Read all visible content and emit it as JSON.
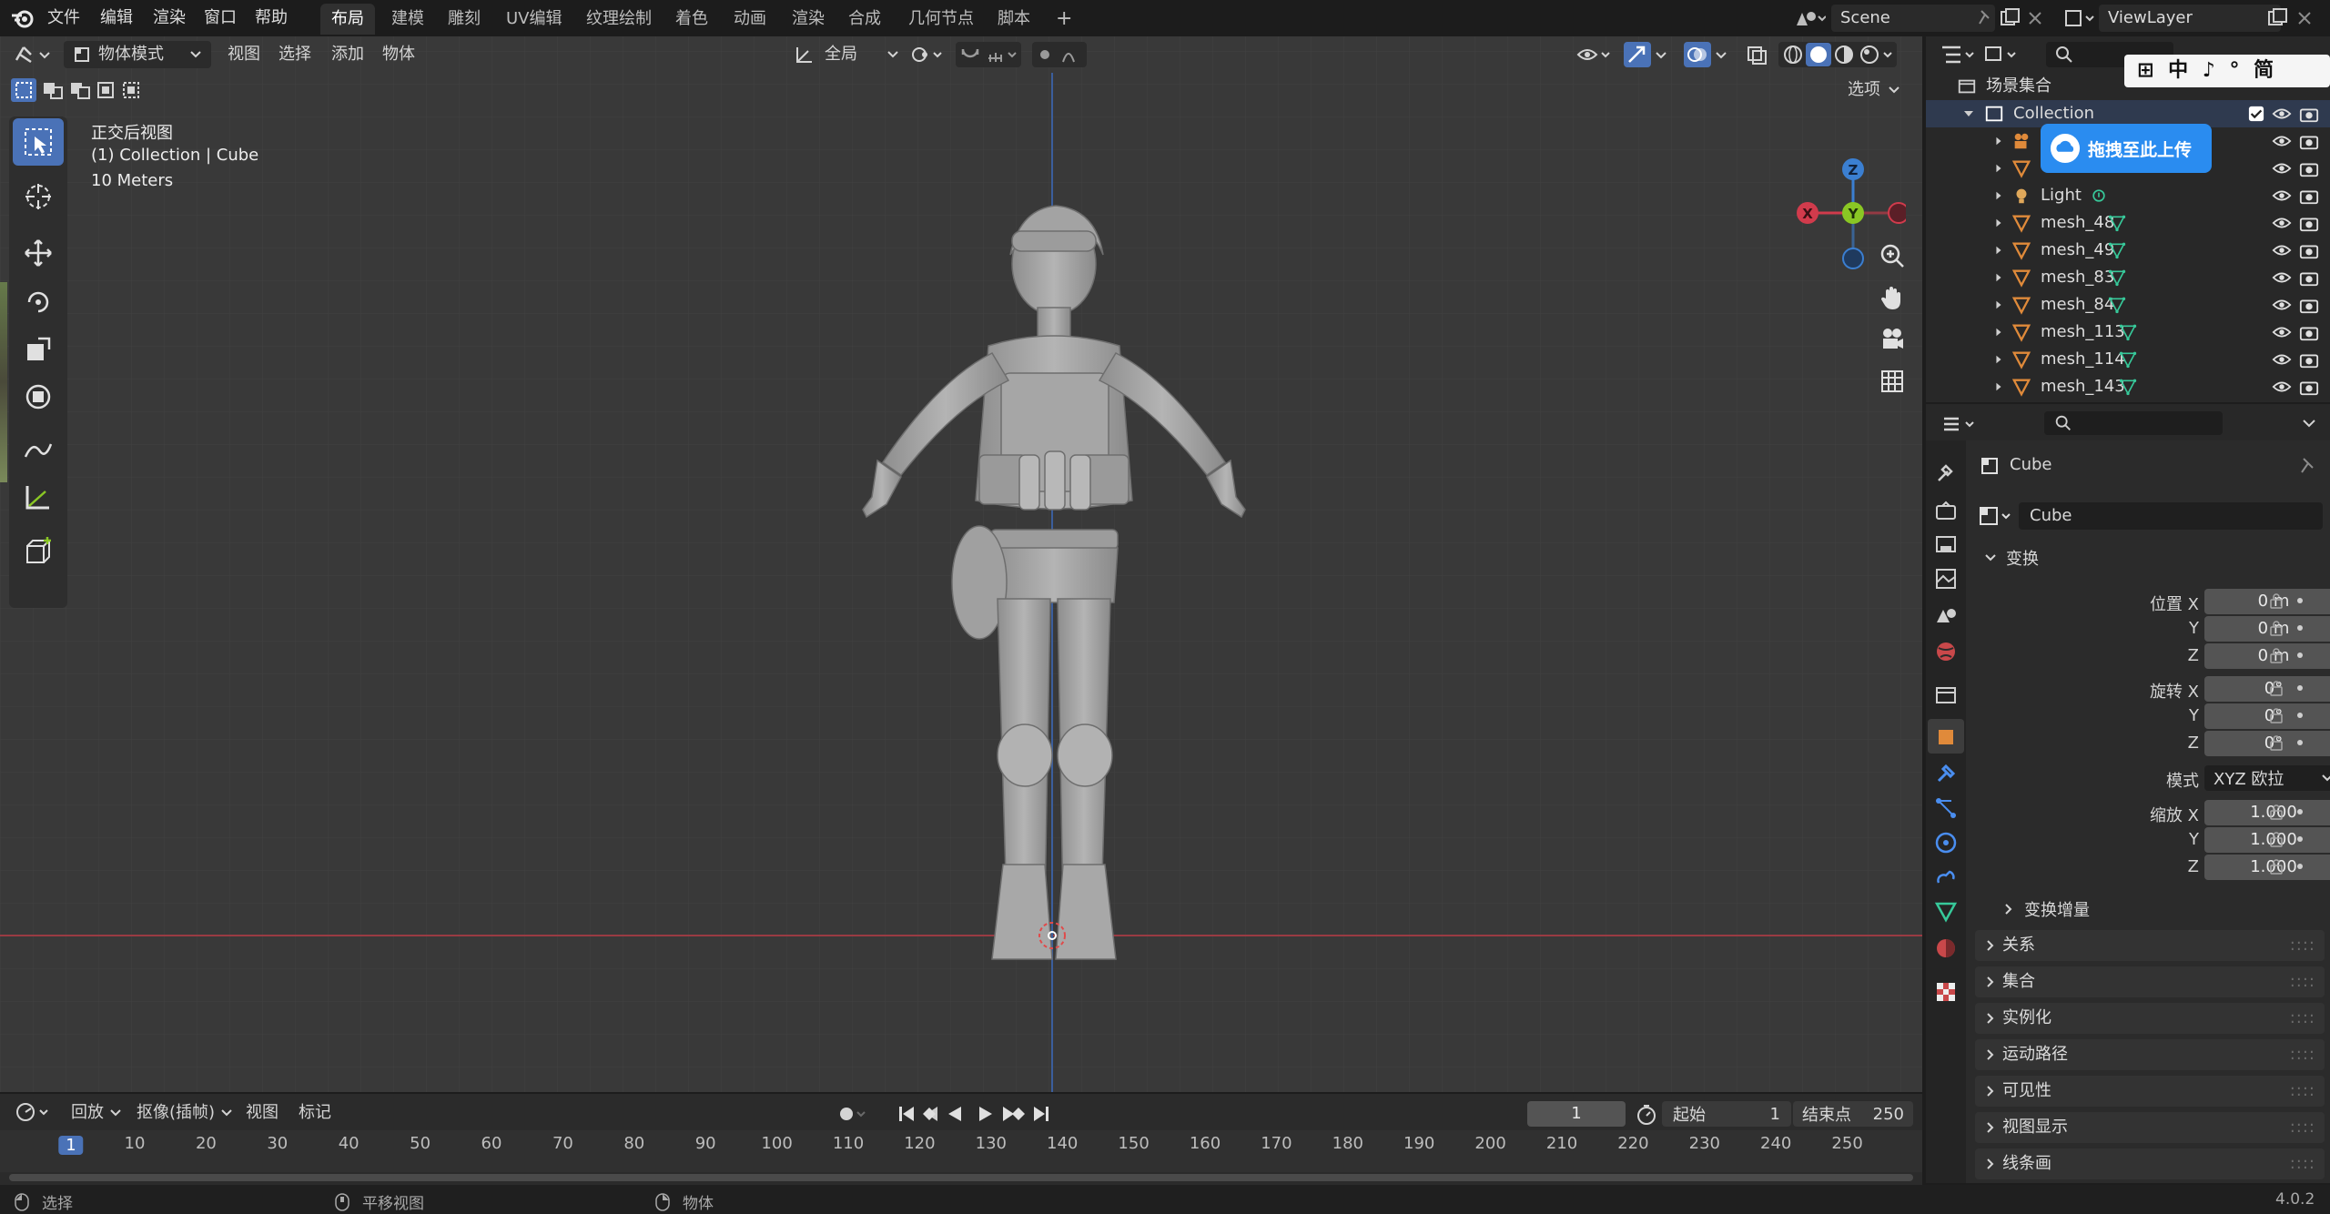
{
  "top_menu": {
    "items": [
      "文件",
      "编辑",
      "渲染",
      "窗口",
      "帮助"
    ],
    "workspaces": [
      "布局",
      "建模",
      "雕刻",
      "UV编辑",
      "纹理绘制",
      "着色",
      "动画",
      "渲染",
      "合成",
      "几何节点",
      "脚本"
    ],
    "add_tab_label": "+",
    "scene_name": "Scene",
    "view_layer": "ViewLayer"
  },
  "viewport_header": {
    "mode": "物体模式",
    "menus": [
      "视图",
      "选择",
      "添加",
      "物体"
    ],
    "transform_orientation": "全局",
    "options_label": "选项"
  },
  "viewport_overlay": {
    "view_name": "正交后视图",
    "collection_path": "(1) Collection | Cube",
    "scale": "10 Meters"
  },
  "gizmo": {
    "z": "Z",
    "x": "X",
    "y": "Y"
  },
  "timeline": {
    "menus": [
      "回放",
      "抠像(插帧)",
      "视图",
      "标记"
    ],
    "current_frame": "1",
    "start_label": "起始",
    "start_value": "1",
    "end_label": "结束点",
    "end_value": "250",
    "ticks": [
      "1",
      "10",
      "20",
      "30",
      "40",
      "50",
      "60",
      "70",
      "80",
      "90",
      "100",
      "110",
      "120",
      "130",
      "140",
      "150",
      "160",
      "170",
      "180",
      "190",
      "200",
      "210",
      "220",
      "230",
      "240",
      "250"
    ]
  },
  "statusbar": {
    "select": "选择",
    "pan": "平移视图",
    "object": "物体",
    "version": "4.0.2"
  },
  "outliner": {
    "root": "场景集合",
    "collection": "Collection",
    "upload_badge": "拖拽至此上传",
    "ime_bar": "⊞ 中 ♪ ° 简",
    "items": [
      "Light",
      "mesh_48",
      "mesh_49",
      "mesh_83",
      "mesh_84",
      "mesh_113",
      "mesh_114",
      "mesh_143"
    ]
  },
  "properties": {
    "object_name": "Cube",
    "data_name": "Cube",
    "transform_header": "变换",
    "location_label": "位置 X",
    "y_label": "Y",
    "z_label": "Z",
    "location": [
      "0 m",
      "0 m",
      "0 m"
    ],
    "rotation_label": "旋转 X",
    "rotation": [
      "0°",
      "0°",
      "0°"
    ],
    "mode_label": "模式",
    "mode_value": "XYZ 欧拉",
    "scale_label": "缩放 X",
    "scale": [
      "1.000",
      "1.000",
      "1.000"
    ],
    "delta_transform": "变换增量",
    "panels": [
      "关系",
      "集合",
      "实例化",
      "运动路径",
      "可见性",
      "视图显示",
      "线条画"
    ]
  },
  "colors": {
    "accent": "#4a72b7",
    "x_axis": "#d13b4c",
    "y_axis": "#8ac724",
    "z_axis": "#3b7fd1",
    "mesh_icon": "#e08a3a",
    "data_icon": "#37c99a"
  }
}
